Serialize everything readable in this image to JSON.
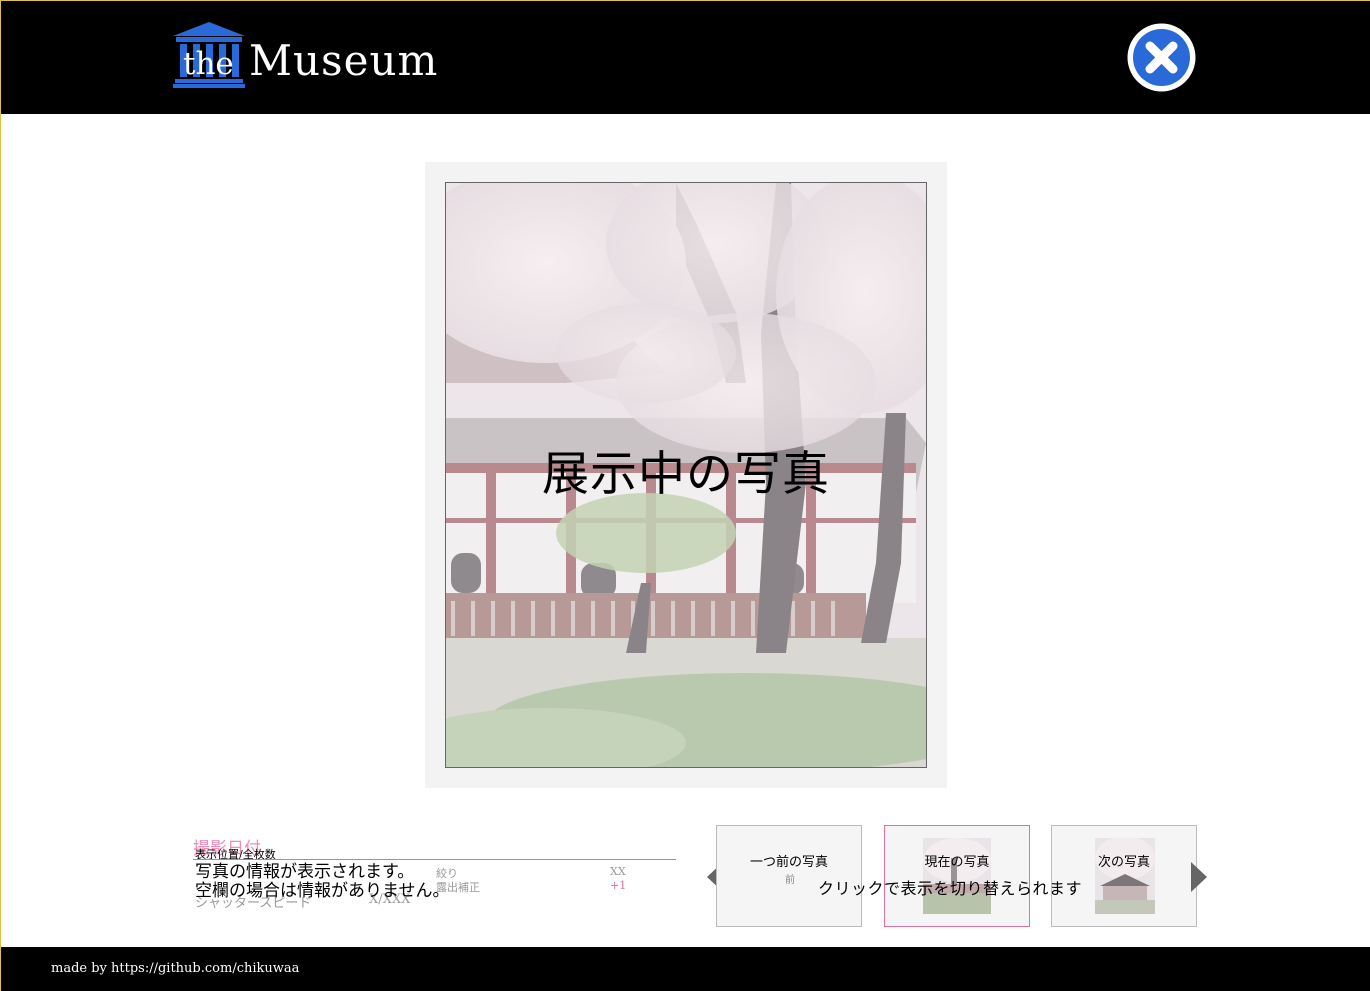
{
  "header": {
    "logo_the": "the",
    "logo_museum": "Museum",
    "close_icon": "close-circle-icon",
    "logo_icon": "museum-building-icon"
  },
  "main": {
    "photo_caption": "展示中の写真"
  },
  "info": {
    "date_label": "撮影日付",
    "position_label": "表示位置/全枚数",
    "note_line1": "写真の情報が表示されます。",
    "note_line2": "空欄の場合は情報がありません。",
    "aperture_label": "絞り",
    "aperture_value": "XX",
    "exposure_label": "露出補正",
    "exposure_value": "+1",
    "shutter_label": "シャッタースピード",
    "shutter_value": "X/XXX"
  },
  "nav": {
    "prev_arrow": "chevron-left-icon",
    "next_arrow": "chevron-right-icon",
    "thumbs": [
      {
        "label": "一つ前の写真",
        "sub": "前"
      },
      {
        "label": "現在の写真",
        "sub": ""
      },
      {
        "label": "次の写真",
        "sub": ""
      }
    ],
    "switch_hint": "クリックで表示を切り替えられます"
  },
  "footer": {
    "credit": "made by https://github.com/chikuwaa"
  },
  "colors": {
    "accent_blue": "#2a6ad8",
    "accent_pink": "#e070a0",
    "header_bg": "#000000"
  }
}
